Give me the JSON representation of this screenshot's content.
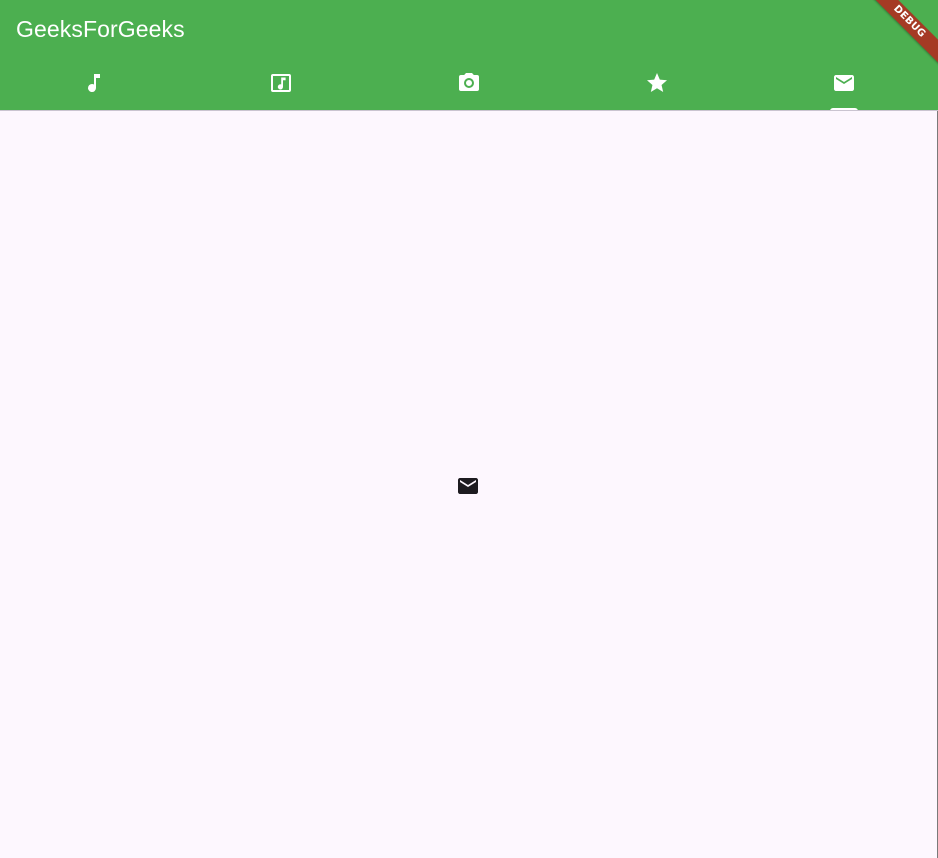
{
  "app_bar": {
    "title": "GeeksForGeeks",
    "background_color": "#4caf50",
    "title_color": "#ffffff"
  },
  "tabs": [
    {
      "icon": "music-note-icon",
      "selected": false
    },
    {
      "icon": "music-video-icon",
      "selected": false
    },
    {
      "icon": "camera-icon",
      "selected": false
    },
    {
      "icon": "star-icon",
      "selected": false
    },
    {
      "icon": "mail-icon",
      "selected": true
    }
  ],
  "tab_content": {
    "icon": "mail-icon"
  },
  "debug_banner": {
    "label": "DEBUG",
    "color": "#a53a24"
  }
}
